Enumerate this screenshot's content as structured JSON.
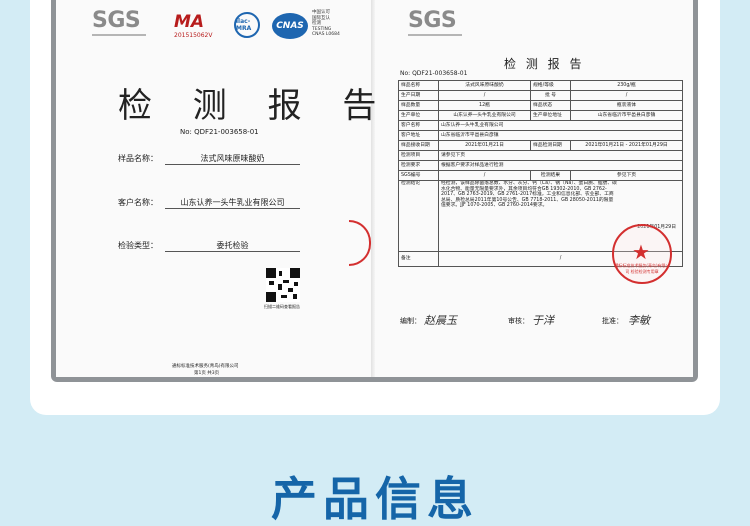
{
  "left_page": {
    "logos": {
      "sgs": "SGS",
      "ma": "MA",
      "ma_code": "201515062V",
      "ilac": "ilac-MRA",
      "cnas": "CNAS",
      "cnas_text": [
        "中国认可",
        "国际互认",
        "检测",
        "TESTING",
        "CNAS L0684"
      ]
    },
    "title": "检 测 报 告",
    "report_no": "No: QDF21-003658-01",
    "fields": [
      {
        "label": "样品名称：",
        "value": "法式风味原味酸奶"
      },
      {
        "label": "客户名称：",
        "value": "山东认养一头牛乳业有限公司"
      },
      {
        "label": "检验类型：",
        "value": "委托检验"
      }
    ],
    "qr_caption": "扫描二维码查看报告",
    "footer": [
      "通标标准技术服务(青岛)有限公司",
      "第1页 共3页"
    ]
  },
  "right_page": {
    "logo": "SGS",
    "title": "检 测 报 告",
    "report_no": "No: QDF21-003658-01",
    "rows": [
      [
        "样品名称",
        "法式风味原味酸奶",
        "规格/等级",
        "230g/瓶"
      ],
      [
        "生产日期",
        "/",
        "批 号",
        "/"
      ],
      [
        "样品数量",
        "12瓶",
        "样品状态",
        "瓶装液体"
      ],
      [
        "生产单位",
        "山东认养一头牛乳业有限公司",
        "生产单位地址",
        "山东省临沂市平邑县白彦镇"
      ],
      [
        "客户名称",
        "山东认养一头牛乳业有限公司",
        "",
        ""
      ],
      [
        "客户地址",
        "山东省临沂市平邑县白彦镇",
        "",
        ""
      ],
      [
        "样品接收日期",
        "2021年01月21日",
        "样品检测日期",
        "2021年01月21日 - 2021年01月29日"
      ],
      [
        "检测项目",
        "请参见下页",
        "",
        ""
      ],
      [
        "检测要求",
        "根据客户要求对样品进行检测",
        "",
        ""
      ],
      [
        "SGS编号",
        "/",
        "检测结果",
        "参见下页"
      ]
    ],
    "conclusion_label": "检测结论",
    "conclusion": "经检测，该样品除菌落总数、水分、灰分、钙（Ca）、钠（Na）、蛋白质、脂肪、碳水化合物、能量无限量要求外，其余项目均符合GB 19302-2010、GB 2762-2017、GB 2763-2019、GB 2761-2017标准，工业和信息化部、农业部、工商总局、质检总局2011年第10号公告、GB 7718-2011、GB 28050-2011的限量值要求。JJF 1070-2005、GB 2760-2014要求。",
    "stamp_text": "通标标准技术服务(青岛)有限公司 检验检测专用章",
    "sign_date": "2021年01月29日",
    "remark_label": "备注",
    "remark_value": "/",
    "signatures": [
      {
        "label": "编制：",
        "name": "赵晨玉"
      },
      {
        "label": "审核：",
        "name": "于洋"
      },
      {
        "label": "批准：",
        "name": "李敏"
      }
    ]
  },
  "bottom_title": "产品信息"
}
